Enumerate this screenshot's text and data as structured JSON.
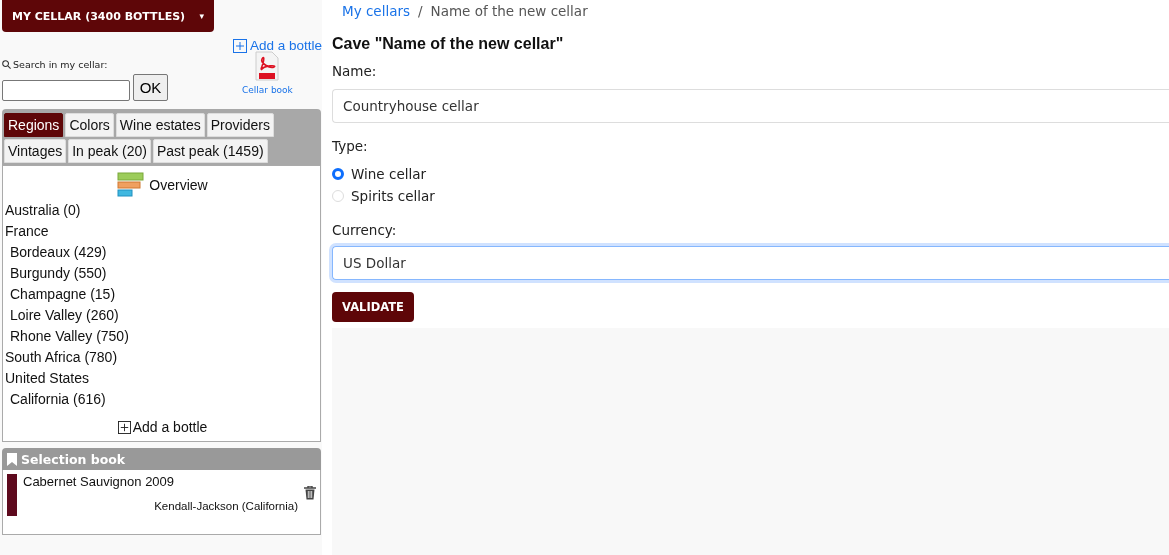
{
  "cellar_menu": {
    "label": "MY CELLAR (3400 BOTTLES)",
    "caret": "▾"
  },
  "add_bottle_link": "Add a bottle",
  "search": {
    "label": "Search in my cellar:",
    "button": "OK"
  },
  "cellar_book": {
    "label": "Cellar book"
  },
  "tabs": [
    {
      "label": "Regions",
      "selected": true
    },
    {
      "label": "Colors",
      "selected": false
    },
    {
      "label": "Wine estates",
      "selected": false
    },
    {
      "label": "Providers",
      "selected": false
    },
    {
      "label": "Vintages",
      "selected": false
    },
    {
      "label": "In peak (20)",
      "selected": false
    },
    {
      "label": "Past peak (1459)",
      "selected": false
    }
  ],
  "overview": "Overview",
  "regions": [
    {
      "label": "Australia (0)"
    },
    {
      "label": "France",
      "children": [
        {
          "label": "Bordeaux (429)"
        },
        {
          "label": "Burgundy (550)"
        },
        {
          "label": "Champagne (15)"
        },
        {
          "label": "Loire Valley (260)"
        },
        {
          "label": "Rhone Valley (750)"
        }
      ]
    },
    {
      "label": "South Africa (780)"
    },
    {
      "label": "United States",
      "children": [
        {
          "label": "California (616)"
        }
      ]
    }
  ],
  "add_bottle_button": "Add a bottle",
  "selection_book": {
    "title": "Selection book",
    "items": [
      {
        "name": "Cabernet Sauvignon 2009",
        "estate": "Kendall-Jackson (California)",
        "color": "#5e0a1e"
      }
    ]
  },
  "breadcrumb_separator": "/",
  "breadcrumb": [
    {
      "label": "My cellars",
      "link": true
    },
    {
      "label": "Name of the new cellar",
      "link": false
    }
  ],
  "heading": "Cave \"Name of the new cellar\"",
  "form": {
    "name_label": "Name:",
    "name_value": "Countryhouse cellar",
    "type_label": "Type:",
    "types": [
      {
        "label": "Wine cellar",
        "selected": true
      },
      {
        "label": "Spirits cellar",
        "selected": false
      }
    ],
    "currency_label": "Currency:",
    "currency_value": "US Dollar",
    "submit": "VALIDATE"
  }
}
